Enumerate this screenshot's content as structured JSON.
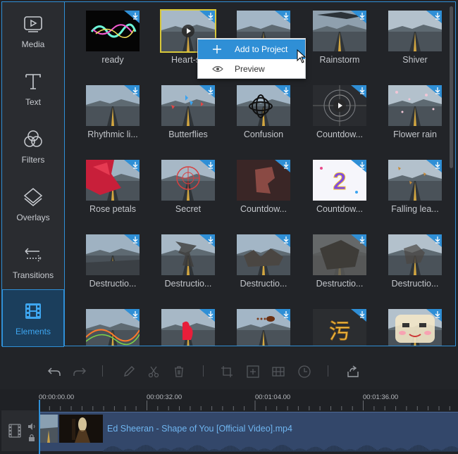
{
  "sidebar": {
    "items": [
      {
        "label": "Media",
        "icon": "media-icon",
        "active": false
      },
      {
        "label": "Text",
        "icon": "text-icon",
        "active": false
      },
      {
        "label": "Filters",
        "icon": "filters-icon",
        "active": false
      },
      {
        "label": "Overlays",
        "icon": "overlays-icon",
        "active": false
      },
      {
        "label": "Transitions",
        "icon": "transitions-icon",
        "active": false
      },
      {
        "label": "Elements",
        "icon": "elements-icon",
        "active": true
      }
    ]
  },
  "elements": [
    {
      "label": "ready"
    },
    {
      "label": "Heart-sh"
    },
    {
      "label": ""
    },
    {
      "label": "Rainstorm"
    },
    {
      "label": "Shiver"
    },
    {
      "label": "Rhythmic li..."
    },
    {
      "label": "Butterflies"
    },
    {
      "label": "Confusion"
    },
    {
      "label": "Countdow..."
    },
    {
      "label": "Flower rain"
    },
    {
      "label": "Rose petals"
    },
    {
      "label": "Secret"
    },
    {
      "label": "Countdow..."
    },
    {
      "label": "Countdow..."
    },
    {
      "label": "Falling lea..."
    },
    {
      "label": "Destructio..."
    },
    {
      "label": "Destructio..."
    },
    {
      "label": "Destructio..."
    },
    {
      "label": "Destructio..."
    },
    {
      "label": "Destructio..."
    },
    {
      "label": ""
    },
    {
      "label": ""
    },
    {
      "label": ""
    },
    {
      "label": ""
    },
    {
      "label": ""
    }
  ],
  "context_menu": {
    "items": [
      {
        "label": "Add to Project",
        "icon": "plus-icon"
      },
      {
        "label": "Preview",
        "icon": "eye-icon"
      }
    ]
  },
  "toolbar": {
    "tools": [
      "undo-icon",
      "redo-icon",
      "pencil-icon",
      "scissors-icon",
      "trash-icon",
      "crop-icon",
      "zoom-icon",
      "mosaic-icon",
      "clock-icon",
      "share-icon"
    ]
  },
  "timeline": {
    "timecodes": [
      "00:00:00.00",
      "00:00:32.00",
      "00:01:04.00",
      "00:01:36.00"
    ],
    "clip_name": "Ed Sheeran - Shape of You [Official Video].mp4"
  },
  "colors": {
    "accent": "#2f8fd6",
    "background": "#222428",
    "selected_outline": "#d8c83a"
  }
}
